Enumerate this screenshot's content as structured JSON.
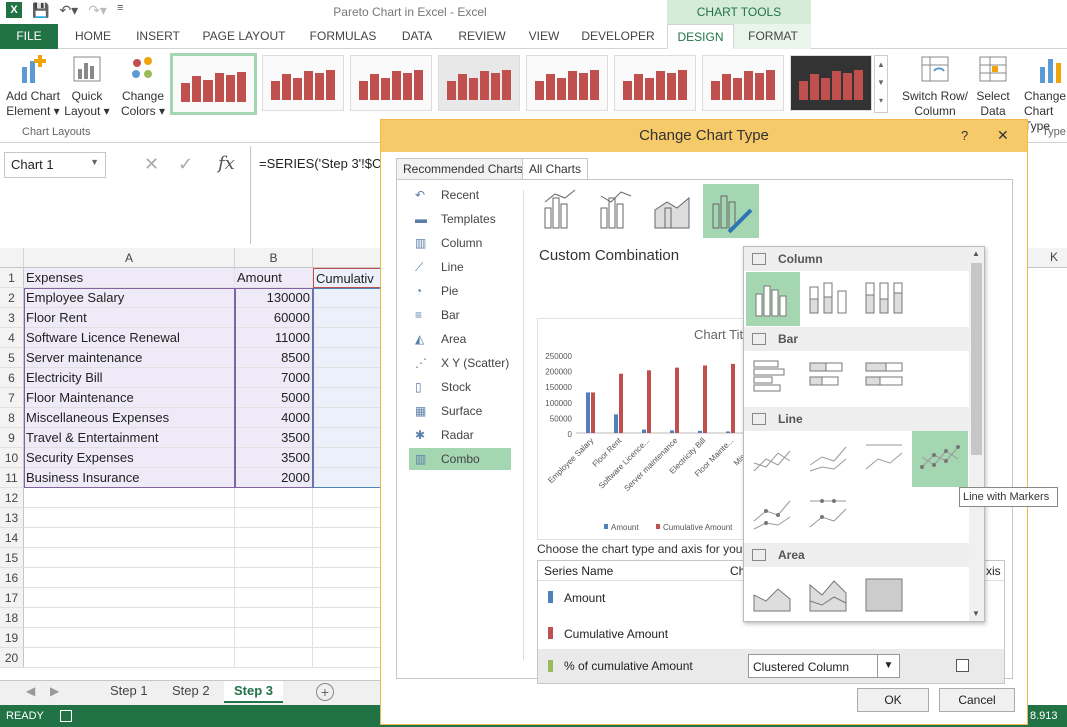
{
  "window": {
    "title": "Pareto Chart in Excel - Excel",
    "context_tab_group": "CHART TOOLS"
  },
  "tabs": [
    "FILE",
    "HOME",
    "INSERT",
    "PAGE LAYOUT",
    "FORMULAS",
    "DATA",
    "REVIEW",
    "VIEW",
    "DEVELOPER",
    "DESIGN",
    "FORMAT"
  ],
  "ribbon": {
    "add_chart_element": "Add Chart Element ▾",
    "quick_layout": "Quick Layout ▾",
    "change_colors": "Change Colors ▾",
    "chart_layouts_label": "Chart Layouts",
    "switch_row_column": "Switch Row/ Column",
    "select_data": "Select Data",
    "change_chart_type": "Change Chart Type",
    "type_label": "Type"
  },
  "formula_bar": {
    "name_box": "Chart 1",
    "fx": "fx",
    "formula": "=SERIES('Step 3'!$C$"
  },
  "grid": {
    "col_headers": [
      "A",
      "B"
    ],
    "col_K": "K",
    "col_c_partial": "Cumulativ",
    "rows": [
      {
        "n": "1",
        "a": "Expenses",
        "b": "Amount"
      },
      {
        "n": "2",
        "a": "Employee Salary",
        "b": "130000"
      },
      {
        "n": "3",
        "a": "Floor Rent",
        "b": "60000"
      },
      {
        "n": "4",
        "a": "Software Licence Renewal",
        "b": "11000"
      },
      {
        "n": "5",
        "a": "Server maintenance",
        "b": "8500"
      },
      {
        "n": "6",
        "a": "Electricity Bill",
        "b": "7000"
      },
      {
        "n": "7",
        "a": "Floor Maintenance",
        "b": "5000"
      },
      {
        "n": "8",
        "a": "Miscellaneous Expenses",
        "b": "4000"
      },
      {
        "n": "9",
        "a": "Travel & Entertainment",
        "b": "3500"
      },
      {
        "n": "10",
        "a": "Security Expenses",
        "b": "3500"
      },
      {
        "n": "11",
        "a": "Business Insurance",
        "b": "2000"
      },
      {
        "n": "12",
        "a": "",
        "b": ""
      },
      {
        "n": "13",
        "a": "",
        "b": ""
      },
      {
        "n": "14",
        "a": "",
        "b": ""
      },
      {
        "n": "15",
        "a": "",
        "b": ""
      },
      {
        "n": "16",
        "a": "",
        "b": ""
      },
      {
        "n": "17",
        "a": "",
        "b": ""
      },
      {
        "n": "18",
        "a": "",
        "b": ""
      },
      {
        "n": "19",
        "a": "",
        "b": ""
      },
      {
        "n": "20",
        "a": "",
        "b": ""
      }
    ]
  },
  "sheet_tabs": [
    "Step 1",
    "Step 2",
    "Step 3"
  ],
  "status": {
    "ready": "READY",
    "right": "8.913"
  },
  "dialog": {
    "title": "Change Chart Type",
    "help": "?",
    "close": "✕",
    "tab_recommended": "Recommended Charts",
    "tab_all": "All Charts",
    "types": [
      "Recent",
      "Templates",
      "Column",
      "Line",
      "Pie",
      "Bar",
      "Area",
      "X Y (Scatter)",
      "Stock",
      "Surface",
      "Radar",
      "Combo"
    ],
    "heading": "Custom Combination",
    "preview": {
      "title": "Chart Tit",
      "yticks": [
        "250000",
        "200000",
        "150000",
        "100000",
        "50000",
        "0"
      ],
      "xcats": [
        "Employee Salary",
        "Floor Rent",
        "Software Licence...",
        "Server maintenance",
        "Electricity Bill",
        "Floor Mainte...",
        "Miscella..."
      ],
      "legend": [
        "Amount",
        "Cumulative Amount"
      ]
    },
    "choose_text": "Choose the chart type and axis for your d",
    "table_headers": {
      "series": "Series Name",
      "type": "Cha",
      "axis": "xis"
    },
    "series": [
      {
        "name": "Amount",
        "color": "#4f81bd"
      },
      {
        "name": "Cumulative Amount",
        "color": "#c0504d"
      },
      {
        "name": "% of cumulative Amount",
        "color": "#9bbb59"
      }
    ],
    "series3_type": "Clustered Column",
    "ok": "OK",
    "cancel": "Cancel"
  },
  "dropdown": {
    "sections": [
      "Column",
      "Bar",
      "Line",
      "Area"
    ],
    "tooltip": "Line with Markers"
  },
  "colors": {
    "accent": "#217346",
    "dialog_title": "#f6c969",
    "selection": "#a5d6b2",
    "bar_red": "#c0504d",
    "bar_blue": "#4f81bd"
  }
}
